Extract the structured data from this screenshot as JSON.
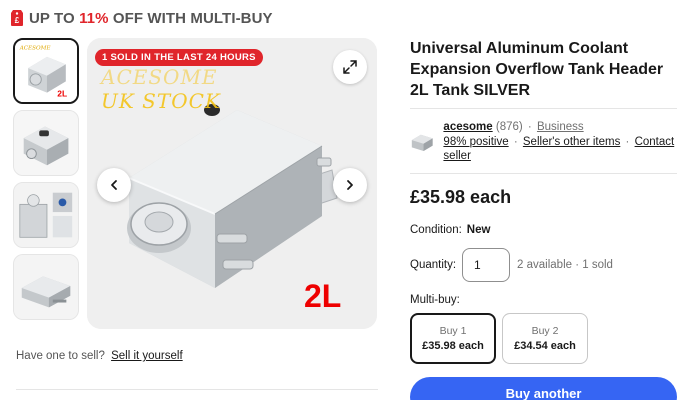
{
  "promo": {
    "prefix": "UP TO ",
    "percent": "11%",
    "suffix": " OFF WITH MULTI-BUY",
    "icon": "price-tag-icon",
    "accent_color": "#e0252b"
  },
  "gallery": {
    "sold_badge": "1 SOLD IN THE LAST 24 HOURS",
    "watermark_line1": "ACESOME",
    "watermark_line2": "UK STOCK",
    "size_label": "2L",
    "thumb_count_visible": 4
  },
  "sell": {
    "question": "Have one to sell?",
    "link": "Sell it yourself"
  },
  "listing": {
    "title": "Universal Aluminum Coolant Expansion Overflow Tank Header 2L Tank SILVER",
    "price": "£35.98 each",
    "condition_label": "Condition:",
    "condition_value": "New"
  },
  "seller": {
    "name": "acesome",
    "feedback_count": "(876)",
    "type": "Business",
    "positive": "98% positive",
    "other_items": "Seller's other items",
    "contact": "Contact seller"
  },
  "quantity": {
    "label": "Quantity:",
    "value": "1",
    "available": "2 available",
    "sold": "1 sold"
  },
  "multibuy": {
    "label": "Multi-buy:",
    "options": [
      {
        "label": "Buy 1",
        "price": "£35.98 each",
        "selected": true
      },
      {
        "label": "Buy 2",
        "price": "£34.54 each",
        "selected": false
      }
    ]
  },
  "actions": {
    "buy_another": "Buy another",
    "primary_color": "#3665f3"
  }
}
